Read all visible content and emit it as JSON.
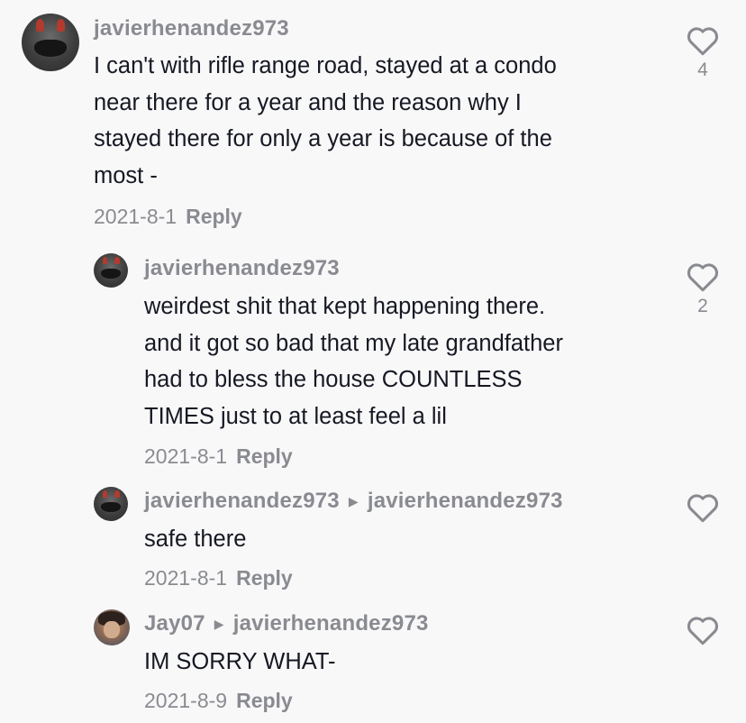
{
  "comments": [
    {
      "username": "javierhenandez973",
      "text": "I can't with rifle range road, stayed at a condo\nnear there for a year and the reason why I\nstayed there for only a year is because of the\nmost -",
      "date": "2021-8-1",
      "reply_label": "Reply",
      "likes": "4",
      "avatar_icon": "devil-mask-avatar"
    },
    {
      "username": "javierhenandez973",
      "text": "weirdest shit that kept happening there.\nand it got so bad that my late grandfather\nhad to bless the house COUNTLESS\nTIMES just to at least feel a lil",
      "date": "2021-8-1",
      "reply_label": "Reply",
      "likes": "2",
      "avatar_icon": "devil-mask-avatar"
    },
    {
      "username": "javierhenandez973",
      "reply_to": "javierhenandez973",
      "text": "safe there",
      "date": "2021-8-1",
      "reply_label": "Reply",
      "avatar_icon": "devil-mask-avatar"
    },
    {
      "username": "Jay07",
      "reply_to": "javierhenandez973",
      "text": "IM SORRY WHAT-",
      "date": "2021-8-9",
      "reply_label": "Reply",
      "avatar_icon": "person-photo-avatar"
    }
  ],
  "icons": {
    "like": "heart-outline-icon",
    "reply_arrow": "triangle-right-icon"
  },
  "colors": {
    "background": "#f8f8f8",
    "text": "#161823",
    "muted": "#8a8b91"
  }
}
